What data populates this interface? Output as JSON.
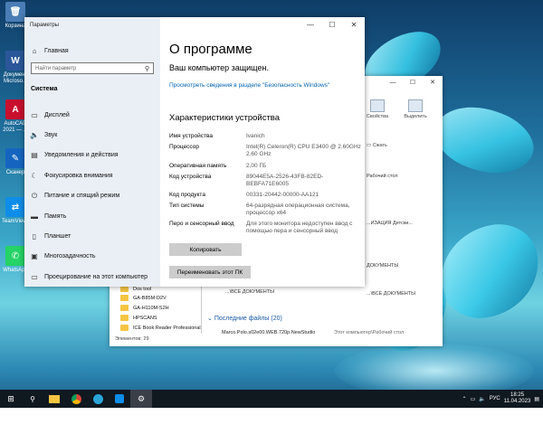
{
  "desktop": {
    "icons": [
      {
        "label": "Корзина",
        "color": "#4a7db5",
        "glyph": "🗑",
        "icon": "recycle-bin-icon"
      },
      {
        "label": "Документ Microso...",
        "color": "#2b579a",
        "glyph": "W",
        "icon": "word-document-icon"
      },
      {
        "label": "AutoCAD 2021 — ...",
        "color": "#c8102e",
        "glyph": "A",
        "icon": "autocad-icon"
      },
      {
        "label": "Сканер",
        "color": "#1565c0",
        "glyph": "✎",
        "icon": "scanner-icon"
      },
      {
        "label": "TeamViewer",
        "color": "#0e8ee9",
        "glyph": "⇄",
        "icon": "teamviewer-icon"
      },
      {
        "label": "WhatsApp",
        "color": "#25d366",
        "glyph": "✆",
        "icon": "whatsapp-icon"
      }
    ]
  },
  "settings": {
    "window_title": "Параметры",
    "home": "Главная",
    "search_placeholder": "Найти параметр",
    "section": "Система",
    "nav": [
      {
        "label": "Дисплей",
        "icon": "display-icon"
      },
      {
        "label": "Звук",
        "icon": "sound-icon"
      },
      {
        "label": "Уведомления и действия",
        "icon": "notifications-icon"
      },
      {
        "label": "Фокусировка внимания",
        "icon": "focus-assist-icon"
      },
      {
        "label": "Питание и спящий режим",
        "icon": "power-icon"
      },
      {
        "label": "Память",
        "icon": "storage-icon"
      },
      {
        "label": "Планшет",
        "icon": "tablet-icon"
      },
      {
        "label": "Многозадачность",
        "icon": "multitasking-icon"
      },
      {
        "label": "Проецирование на этот компьютер",
        "icon": "projecting-icon"
      }
    ],
    "page_title": "О программе",
    "protected": "Ваш компьютер защищен.",
    "security_link": "Просмотреть сведения в разделе \"Безопасность Windows\"",
    "spec_heading": "Характеристики устройства",
    "specs": [
      {
        "label": "Имя устройства",
        "value": "Ivanich"
      },
      {
        "label": "Процессор",
        "value": "Intel(R) Celeron(R) CPU      E3400  @ 2.60GHz   2.60 GHz"
      },
      {
        "label": "Оперативная память",
        "value": "2,00 ГБ"
      },
      {
        "label": "Код устройства",
        "value": "89044E5A-2526-43FB-82ED-BEBFA71E6005"
      },
      {
        "label": "Код продукта",
        "value": "00331-20442-00000-AA121"
      },
      {
        "label": "Тип системы",
        "value": "64-разрядная операционная система, процессор x64"
      },
      {
        "label": "Перо и сенсорный ввод",
        "value": "Для этого монитора недоступен ввод с помощью пера и сенсорный ввод"
      }
    ],
    "copy_button": "Копировать",
    "rename_button": "Переименовать этот ПК"
  },
  "explorer": {
    "ribbon": {
      "properties": "Свойства",
      "select": "Выделить",
      "compress": "Сжать"
    },
    "folders": [
      "Dos tool",
      "GA-B85M-D2V",
      "GA-H110M-S2H",
      "HPSCANS",
      "ICE Book Reader Professional"
    ],
    "right_items": [
      "Рабочий стол",
      "...ИЗАЦИЯ Детски...",
      "ДОКУМЕНТЫ",
      "...\\ВСЕ ДОКУМЕНТЫ",
      "...\\ВСЕ ДОКУМЕНТЫ"
    ],
    "recent_heading": "Последние файлы (20)",
    "recent_file": "Marco.Polo.s02e00.WEB.720p.NewStudio",
    "recent_location": "Этот компьютер\\Рабочий стол",
    "status": "Элементов: 29"
  },
  "taskbar": {
    "lang": "РУС",
    "time": "18:25",
    "date": "11.04.2023"
  }
}
